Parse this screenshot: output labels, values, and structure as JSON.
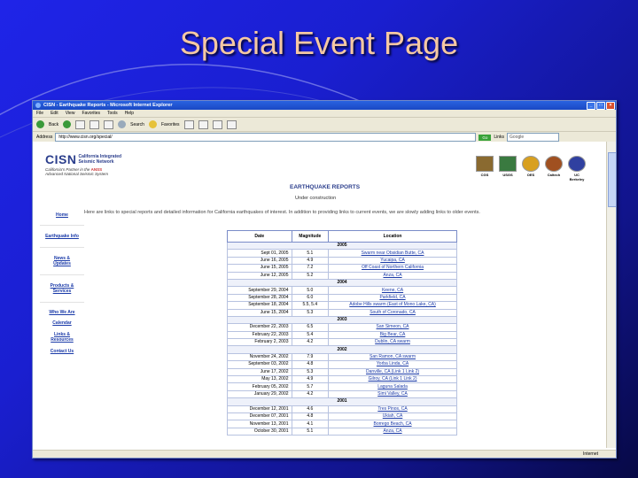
{
  "slide": {
    "title": "Special Event Page"
  },
  "browser": {
    "title": "CISN - Earthquake Reports - Microsoft Internet Explorer",
    "menu": [
      "File",
      "Edit",
      "View",
      "Favorites",
      "Tools",
      "Help"
    ],
    "toolbar": {
      "back": "Back",
      "search": "Search",
      "favorites": "Favorites"
    },
    "address_label": "Address",
    "address": "http://www.cisn.org/special/",
    "go": "Go",
    "links": "Links",
    "google": "Google",
    "status": "Internet"
  },
  "site": {
    "logo": "CISN",
    "logo_sub1": "California Integrated",
    "logo_sub2": "Seismic Network",
    "partner_line1": "California's Partner in the",
    "partner_anss": "ANSS",
    "partner_line2": "Advanced National Seismic System",
    "partners": [
      {
        "label": "CGS",
        "color": "#8a6a30"
      },
      {
        "label": "USGS",
        "color": "#3a7a40"
      },
      {
        "label": "OES",
        "color": "#d8a020"
      },
      {
        "label": "Caltech",
        "color": "#a05020"
      },
      {
        "label": "UC Berkeley",
        "color": "#3040a0"
      }
    ],
    "nav": [
      "Home",
      "Earthquake Info",
      "News & Updates",
      "Products & Services",
      "Who We Are",
      "Calendar",
      "Links & Resources",
      "Contact Us"
    ],
    "heading": "EARTHQUAKE REPORTS",
    "under": "Under construction",
    "intro": "Here are links to special reports and detailed information for California earthquakes of interest. In addition to providing links to current events, we are slowly adding links to older events."
  },
  "table": {
    "headers": [
      "Date",
      "Magnitude",
      "Location"
    ],
    "groups": [
      {
        "year": "2005",
        "rows": [
          [
            "Sept 01, 2005",
            "5.1",
            "Swarm near Obsidian Butte, CA"
          ],
          [
            "June 16, 2005",
            "4.9",
            "Yucaipa, CA"
          ],
          [
            "June 15, 2005",
            "7.2",
            "Off Coast of Northern California"
          ],
          [
            "June 12, 2005",
            "5.2",
            "Anza, CA"
          ]
        ]
      },
      {
        "year": "2004",
        "rows": [
          [
            "September 29, 2004",
            "5.0",
            "Keene, CA"
          ],
          [
            "September 28, 2004",
            "6.0",
            "Parkfield, CA"
          ],
          [
            "September 18, 2004",
            "5.5, 5.4",
            "Adobe Hills swarm (East of Mono Lake, CA)"
          ],
          [
            "June 15, 2004",
            "5.3",
            "South of Coronado, CA"
          ]
        ]
      },
      {
        "year": "2003",
        "rows": [
          [
            "December 22, 2003",
            "6.5",
            "San Simeon, CA"
          ],
          [
            "February 22, 2003",
            "5.4",
            "Big Bear, CA"
          ],
          [
            "February 2, 2003",
            "4.2",
            "Dublin, CA swarm"
          ]
        ]
      },
      {
        "year": "2002",
        "rows": [
          [
            "November 24, 2002",
            "7.9",
            "San Ramon, CA swarm"
          ],
          [
            "September 03, 2002",
            "4.8",
            "Yorba Linda, CA"
          ],
          [
            "June 17, 2002",
            "5.3",
            "Danville, CA (Link 1 Link 2)"
          ],
          [
            "May 13, 2002",
            "4.9",
            "Gilroy, CA (Link 1 Link 2)"
          ],
          [
            "February 05, 2002",
            "5.7",
            "Laguna Salada"
          ],
          [
            "January 29, 2002",
            "4.2",
            "Simi Valley, CA"
          ]
        ]
      },
      {
        "year": "2001",
        "rows": [
          [
            "December 12, 2001",
            "4.6",
            "Tres Pinos, CA"
          ],
          [
            "December 07, 2001",
            "4.8",
            "Ukiah, CA"
          ],
          [
            "November 13, 2001",
            "4.1",
            "Borrego Beach, CA"
          ],
          [
            "October 30, 2001",
            "5.1",
            "Anza, CA"
          ]
        ]
      }
    ]
  }
}
